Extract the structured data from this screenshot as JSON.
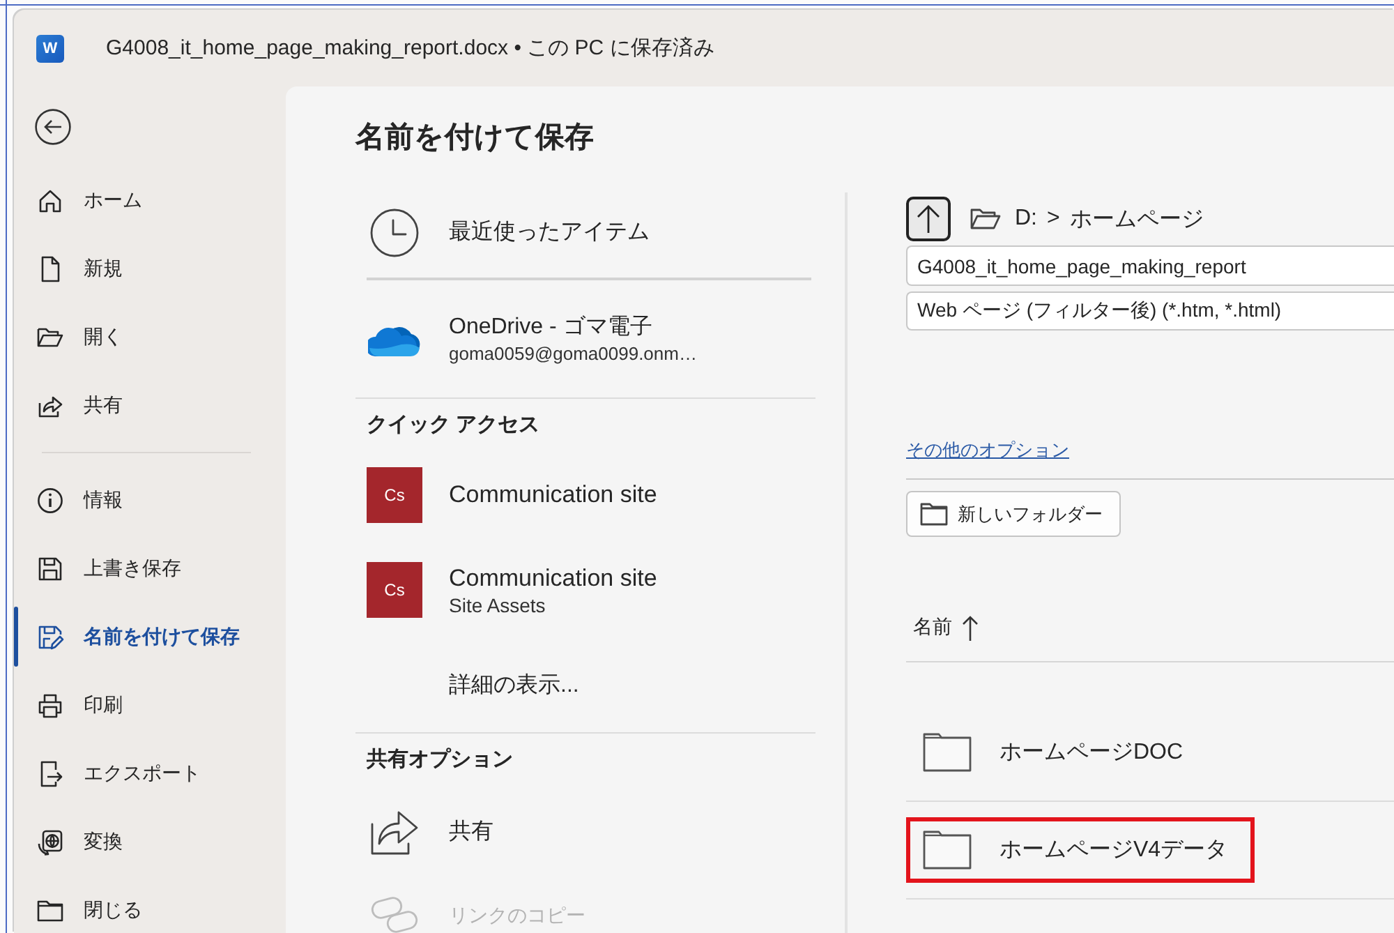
{
  "window": {
    "app_icon": "W",
    "title": "G4008_it_home_page_making_report.docx • この PC に保存済み"
  },
  "sidebar": {
    "groups": [
      [
        {
          "kind": "home",
          "label": "ホーム",
          "selected": false
        },
        {
          "kind": "new",
          "label": "新規",
          "selected": false
        },
        {
          "kind": "open",
          "label": "開く",
          "selected": false
        },
        {
          "kind": "share",
          "label": "共有",
          "selected": false
        }
      ],
      [
        {
          "kind": "info",
          "label": "情報",
          "selected": false
        },
        {
          "kind": "save",
          "label": "上書き保存",
          "selected": false
        },
        {
          "kind": "save-as",
          "label": "名前を付けて保存",
          "selected": true
        },
        {
          "kind": "print",
          "label": "印刷",
          "selected": false
        },
        {
          "kind": "export",
          "label": "エクスポート",
          "selected": false
        },
        {
          "kind": "transform",
          "label": "変換",
          "selected": false
        },
        {
          "kind": "close",
          "label": "閉じる",
          "selected": false
        }
      ]
    ]
  },
  "page": {
    "title": "名前を付けて保存"
  },
  "locations": [
    {
      "kind": "recent",
      "label": "最近使ったアイテム"
    },
    {
      "kind": "onedrive",
      "label": "OneDrive - ゴマ電子",
      "detail": "goma0059@goma0099.onm…"
    }
  ],
  "quick_access": {
    "title": "クイック アクセス",
    "items": [
      {
        "badge": "Cs",
        "label": "Communication site"
      },
      {
        "badge": "Cs",
        "label": "Communication site",
        "detail": "Site Assets"
      }
    ],
    "more": "詳細の表示..."
  },
  "share_options": {
    "title": "共有オプション",
    "items": [
      {
        "kind": "share",
        "label": "共有",
        "disabled": false
      },
      {
        "kind": "link",
        "label": "リンクのコピー",
        "disabled": true
      }
    ]
  },
  "file_pane": {
    "path": [
      "D:",
      "ホームページ"
    ],
    "path_separator": ">",
    "file_name": "G4008_it_home_page_making_report",
    "file_type": "Web ページ (フィルター後) (*.htm, *.html)",
    "more_options": "その他のオプション",
    "new_folder": "新しいフォルダー",
    "column": {
      "label": "名前",
      "ascending": true
    },
    "folders": [
      {
        "name": "ホームページDOC",
        "highlighted": false
      },
      {
        "name": "ホームページV4データ",
        "highlighted": true
      }
    ]
  }
}
